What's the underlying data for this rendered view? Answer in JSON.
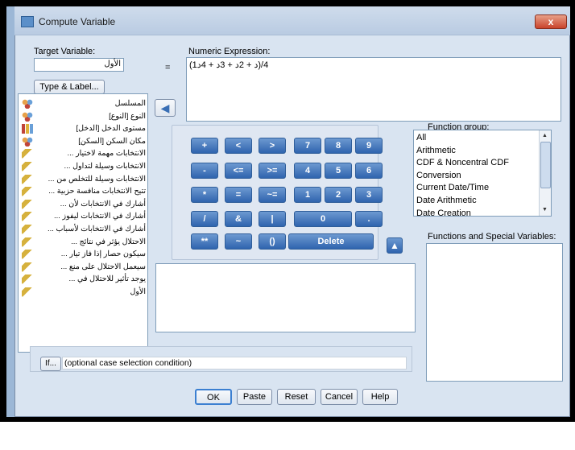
{
  "window": {
    "title": "Compute Variable",
    "close_glyph": "x"
  },
  "target": {
    "label": "Target Variable:",
    "value": "الأول",
    "equals": "=",
    "type_label_button": "Type & Label..."
  },
  "expression": {
    "label": "Numeric Expression:",
    "value": "(1د + 2د + 3د + 4د)/4"
  },
  "variables": [
    {
      "icon": "nominal",
      "name": "المسلسل"
    },
    {
      "icon": "nominal",
      "name": "النوع [النوع]"
    },
    {
      "icon": "ordinal",
      "name": "مستوى الدخل [الدخل]"
    },
    {
      "icon": "nominal",
      "name": "مكان السكن [السكن]"
    },
    {
      "icon": "scale",
      "name": "الانتخابات مهمة لاختيار ..."
    },
    {
      "icon": "scale",
      "name": "الانتخابات وسيلة لتداول ..."
    },
    {
      "icon": "scale",
      "name": "الانتخابات وسيلة للتخلص من ..."
    },
    {
      "icon": "scale",
      "name": "تتيح الانتخابات منافسة حزبية ..."
    },
    {
      "icon": "scale",
      "name": "أشارك في الانتخابات لأن ..."
    },
    {
      "icon": "scale",
      "name": "أشارك في الانتخابات ليفوز ..."
    },
    {
      "icon": "scale",
      "name": "أشارك في الانتخابات لأسباب ..."
    },
    {
      "icon": "scale",
      "name": "الاحتلال يؤثر في نتائج ..."
    },
    {
      "icon": "scale",
      "name": "سيكون حصار إذا فاز تيار ..."
    },
    {
      "icon": "scale",
      "name": "سيعمل الاحتلال على منع ..."
    },
    {
      "icon": "scale",
      "name": "يوجد تأثير للاحتلال في ..."
    },
    {
      "icon": "scale",
      "name": "الأول"
    }
  ],
  "keypad": {
    "rows": [
      [
        "+",
        "<",
        ">",
        "7",
        "8",
        "9"
      ],
      [
        "-",
        "<=",
        ">=",
        "4",
        "5",
        "6"
      ],
      [
        "*",
        "=",
        "~=",
        "1",
        "2",
        "3"
      ],
      [
        "/",
        "&",
        "|",
        "0",
        "."
      ],
      [
        "**",
        "~",
        "()",
        "Delete"
      ]
    ]
  },
  "function_group": {
    "label": "Function group:",
    "items": [
      "All",
      "Arithmetic",
      "CDF & Noncentral CDF",
      "Conversion",
      "Current Date/Time",
      "Date Arithmetic",
      "Date Creation"
    ]
  },
  "functions": {
    "label": "Functions and Special Variables:"
  },
  "if": {
    "button": "If...",
    "text": "(optional case selection condition)"
  },
  "buttons": {
    "ok": "OK",
    "paste": "Paste",
    "reset": "Reset",
    "cancel": "Cancel",
    "help": "Help"
  },
  "colors": {
    "window_bg": "#d9e4f1",
    "keypad_blue": "#2f64ae",
    "close_red": "#c9432b",
    "app_strip": "#9cb7d6"
  }
}
